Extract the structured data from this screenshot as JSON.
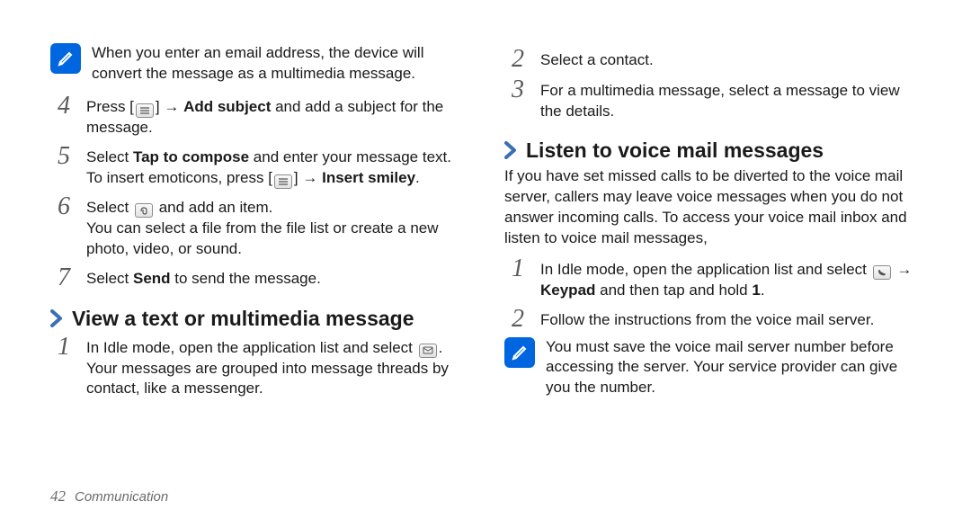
{
  "leftColumn": {
    "callout1": "When you enter an email address, the device will convert the message as a multimedia message.",
    "steps": {
      "s4": {
        "num": "4",
        "a": "Press [",
        "b": "] → ",
        "bold1": "Add subject",
        "c": " and add a subject for the message."
      },
      "s5": {
        "num": "5",
        "a": "Select ",
        "bold1": "Tap to compose",
        "b": " and enter your message text.",
        "c": "To insert emoticons, press [",
        "d": "] → ",
        "bold2": "Insert smiley",
        "e": "."
      },
      "s6": {
        "num": "6",
        "a": "Select ",
        "b": " and add an item.",
        "c": "You can select a file from the file list or create a new photo, video, or sound."
      },
      "s7": {
        "num": "7",
        "a": "Select ",
        "bold1": "Send",
        "b": " to send the message."
      }
    },
    "section": {
      "heading": "View a text or multimedia message",
      "s1": {
        "num": "1",
        "a": "In Idle mode, open the application list and select ",
        "b": ".",
        "c": "Your messages are grouped into message threads by contact, like a messenger."
      }
    }
  },
  "rightColumn": {
    "steps": {
      "s2": {
        "num": "2",
        "a": "Select a contact."
      },
      "s3": {
        "num": "3",
        "a": "For a multimedia message, select a message to view the details."
      }
    },
    "section": {
      "heading": "Listen to voice mail messages",
      "intro": "If you have set missed calls to be diverted to the voice mail server, callers may leave voice messages when you do not answer incoming calls. To access your voice mail inbox and listen to voice mail messages,",
      "s1": {
        "num": "1",
        "a": "In Idle mode, open the application list and select ",
        "b": " → ",
        "bold1": "Keypad",
        "c": " and then tap and hold ",
        "bold2": "1",
        "d": "."
      },
      "s2": {
        "num": "2",
        "a": "Follow the instructions from the voice mail server."
      },
      "callout2": "You must save the voice mail server number before accessing the server. Your service provider can give you the number."
    }
  },
  "footer": {
    "pageNumber": "42",
    "title": "Communication"
  },
  "icons": {
    "menu": "menu-icon",
    "attach": "paperclip-icon",
    "message": "message-icon",
    "phone": "phone-icon",
    "chevron": "chevron-right-icon",
    "note": "note-icon"
  },
  "colors": {
    "accent": "#0066e0",
    "chevron": "#3a6fb3"
  }
}
